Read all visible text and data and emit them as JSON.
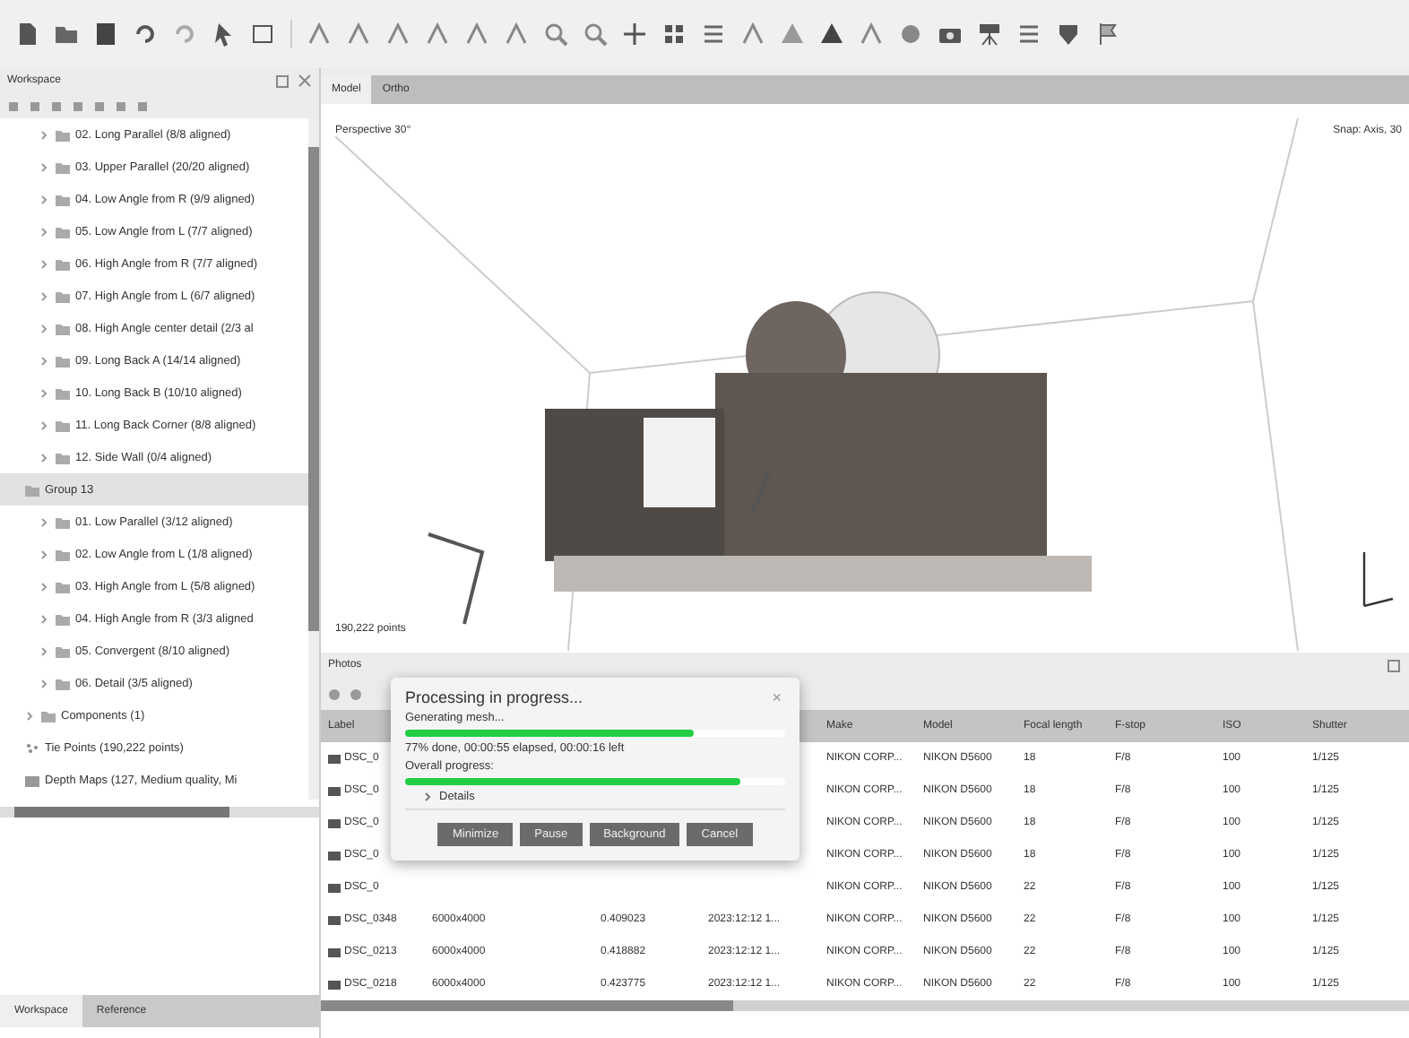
{
  "workspace_panel": {
    "title": "Workspace",
    "tree": [
      {
        "kind": "folder",
        "label": "02. Long Parallel (8/8 aligned)",
        "expanded": false,
        "selected": false
      },
      {
        "kind": "folder",
        "label": "03. Upper Parallel (20/20 aligned)",
        "expanded": false,
        "selected": false
      },
      {
        "kind": "folder",
        "label": "04. Low Angle from R (9/9 aligned)",
        "expanded": false,
        "selected": false
      },
      {
        "kind": "folder",
        "label": "05. Low Angle from L (7/7 aligned)",
        "expanded": false,
        "selected": false
      },
      {
        "kind": "folder",
        "label": "06. High Angle from R (7/7 aligned)",
        "expanded": false,
        "selected": false
      },
      {
        "kind": "folder",
        "label": "07. High Angle from L (6/7 aligned)",
        "expanded": false,
        "selected": false
      },
      {
        "kind": "folder",
        "label": "08. High Angle center detail (2/3 al",
        "expanded": false,
        "selected": false
      },
      {
        "kind": "folder",
        "label": "09. Long Back A (14/14 aligned)",
        "expanded": false,
        "selected": false
      },
      {
        "kind": "folder",
        "label": "10. Long Back B (10/10 aligned)",
        "expanded": false,
        "selected": false
      },
      {
        "kind": "folder",
        "label": "11. Long Back Corner (8/8 aligned)",
        "expanded": false,
        "selected": false
      },
      {
        "kind": "folder",
        "label": "12. Side Wall (0/4 aligned)",
        "expanded": false,
        "selected": false
      },
      {
        "kind": "group",
        "label": "Group 13",
        "selected": true
      },
      {
        "kind": "folder",
        "label": "01. Low Parallel (3/12 aligned)",
        "expanded": false,
        "selected": false
      },
      {
        "kind": "folder",
        "label": "02. Low Angle from L (1/8 aligned)",
        "expanded": false,
        "selected": false
      },
      {
        "kind": "folder",
        "label": "03. High Angle from L (5/8 aligned)",
        "expanded": false,
        "selected": false
      },
      {
        "kind": "folder",
        "label": "04. High Angle from R (3/3 aligned",
        "expanded": false,
        "selected": false
      },
      {
        "kind": "folder",
        "label": "05. Convergent (8/10 aligned)",
        "expanded": false,
        "selected": false
      },
      {
        "kind": "folder",
        "label": "06. Detail (3/5 aligned)",
        "expanded": false,
        "selected": false
      },
      {
        "kind": "components",
        "label": "Components (1)",
        "expanded": false,
        "selected": false
      },
      {
        "kind": "tiepoints",
        "label": "Tie Points (190,222 points)",
        "selected": false
      },
      {
        "kind": "depthmaps",
        "label": "Depth Maps (127, Medium quality, Mi",
        "selected": false
      }
    ],
    "bottom_tabs": [
      {
        "label": "Workspace",
        "selected": true
      },
      {
        "label": "Reference",
        "selected": false
      }
    ]
  },
  "view_tabs": [
    {
      "label": "Model",
      "selected": true
    },
    {
      "label": "Ortho",
      "selected": false
    }
  ],
  "viewport": {
    "projection": "Perspective 30°",
    "snap": "Snap: Axis, 30",
    "point_count": "190,222 points"
  },
  "photos_panel": {
    "title": "Photos",
    "columns": [
      "Label",
      null,
      null,
      null,
      "Make",
      "Model",
      "Focal length",
      "F-stop",
      "ISO",
      "Shutter"
    ],
    "rows": [
      [
        "DSC_0",
        null,
        null,
        null,
        "NIKON CORP...",
        "NIKON D5600",
        "18",
        "F/8",
        "100",
        "1/125"
      ],
      [
        "DSC_0",
        null,
        null,
        null,
        "NIKON CORP...",
        "NIKON D5600",
        "18",
        "F/8",
        "100",
        "1/125"
      ],
      [
        "DSC_0",
        null,
        null,
        null,
        "NIKON CORP...",
        "NIKON D5600",
        "18",
        "F/8",
        "100",
        "1/125"
      ],
      [
        "DSC_0",
        null,
        null,
        null,
        "NIKON CORP...",
        "NIKON D5600",
        "18",
        "F/8",
        "100",
        "1/125"
      ],
      [
        "DSC_0",
        null,
        null,
        null,
        "NIKON CORP...",
        "NIKON D5600",
        "22",
        "F/8",
        "100",
        "1/125"
      ],
      [
        "DSC_0348",
        "6000x4000",
        "0.409023",
        "2023:12:12 1...",
        "NIKON CORP...",
        "NIKON D5600",
        "22",
        "F/8",
        "100",
        "1/125"
      ],
      [
        "DSC_0213",
        "6000x4000",
        "0.418882",
        "2023:12:12 1...",
        "NIKON CORP...",
        "NIKON D5600",
        "22",
        "F/8",
        "100",
        "1/125"
      ],
      [
        "DSC_0218",
        "6000x4000",
        "0.423775",
        "2023:12:12 1...",
        "NIKON CORP...",
        "NIKON D5600",
        "22",
        "F/8",
        "100",
        "1/125"
      ]
    ]
  },
  "progress_dialog": {
    "title": "Processing in progress...",
    "close": "×",
    "task": "Generating mesh...",
    "task_progress": {
      "level": 0.76
    },
    "status": "77% done, 00:00:55 elapsed, 00:00:16 left",
    "overall_label": "Overall progress:",
    "overall_progress": {
      "level": 0.88
    },
    "details": {
      "label": "Details",
      "expanded": false
    },
    "buttons": [
      "Minimize",
      "Pause",
      "Background",
      "Cancel"
    ]
  }
}
